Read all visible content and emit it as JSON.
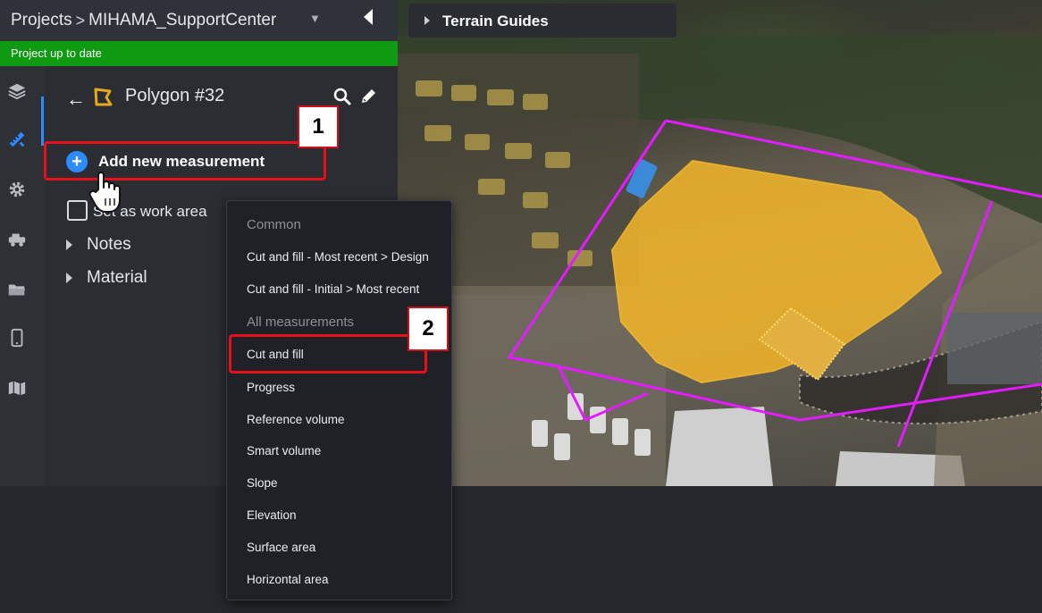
{
  "header": {
    "projects_label": "Projects",
    "separator": ">",
    "project_name": "MIHAMA_SupportCenter"
  },
  "status": {
    "text": "Project up to date",
    "color": "#0e9b12"
  },
  "rail": {
    "icons": [
      "layers-icon",
      "ruler-pencil-icon",
      "gear-icon",
      "vehicle-icon",
      "folder-icon",
      "mobile-icon",
      "map-icon"
    ],
    "active_color": "#2e8bff"
  },
  "panel": {
    "back": "←",
    "title": "Polygon #32",
    "add_measurement": "Add new measurement",
    "work_area_label": "Set as work area",
    "tree": [
      "Notes",
      "Material"
    ]
  },
  "map": {
    "label": "Terrain Guides"
  },
  "menu": {
    "section_common": "Common",
    "common_items": [
      "Cut and fill - Most recent > Design",
      "Cut and fill - Initial > Most recent"
    ],
    "section_all": "All measurements",
    "all_items": [
      "Cut and fill",
      "Progress",
      "Reference volume",
      "Smart volume",
      "Slope",
      "Elevation",
      "Surface area",
      "Horizontal area"
    ]
  },
  "callouts": {
    "step1": "1",
    "step2": "2",
    "highlight_color": "#e5101b"
  }
}
